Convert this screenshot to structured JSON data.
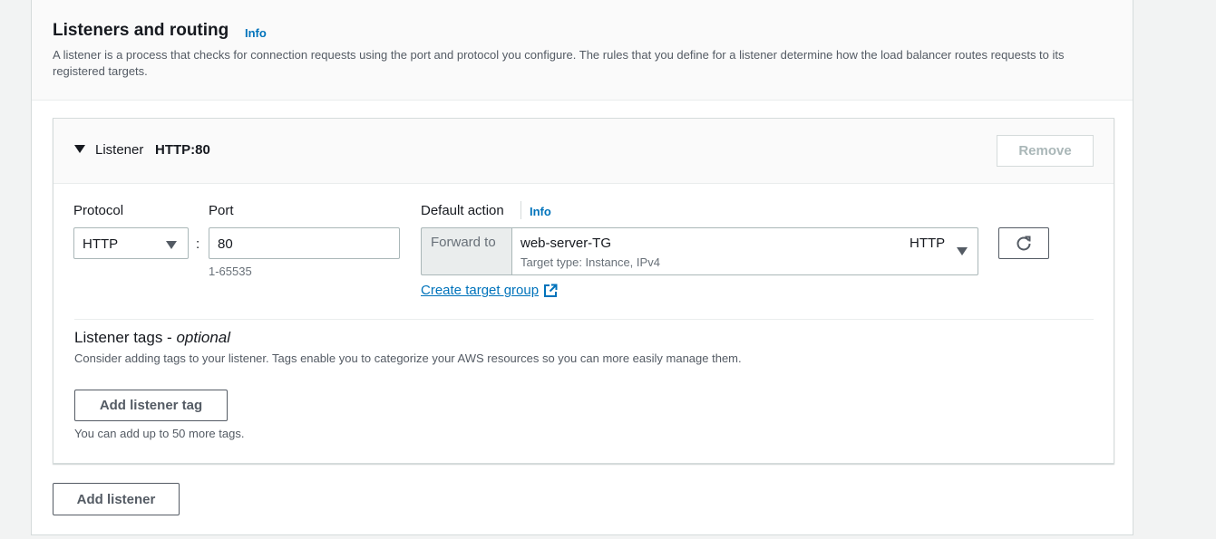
{
  "section": {
    "title": "Listeners and routing",
    "info_label": "Info",
    "description": "A listener is a process that checks for connection requests using the port and protocol you configure. The rules that you define for a listener determine how the load balancer routes requests to its registered targets."
  },
  "listener": {
    "label": "Listener",
    "name": "HTTP:80",
    "remove_label": "Remove",
    "protocol_label": "Protocol",
    "protocol_value": "HTTP",
    "colon": ":",
    "port_label": "Port",
    "port_value": "80",
    "port_hint": "1-65535",
    "default_action_label": "Default action",
    "default_action_info": "Info",
    "forward_to_label": "Forward to",
    "target_group_name": "web-server-TG",
    "target_group_protocol": "HTTP",
    "target_type": "Target type: Instance, IPv4",
    "create_target_group_label": "Create target group"
  },
  "tags": {
    "title": "Listener tags - ",
    "title_optional": "optional",
    "description": "Consider adding tags to your listener. Tags enable you to categorize your AWS resources so you can more easily manage them.",
    "add_tag_label": "Add listener tag",
    "hint": "You can add up to 50 more tags."
  },
  "footer": {
    "add_listener_label": "Add listener"
  },
  "icons": {
    "expand": "caret-down-icon",
    "dropdown": "triangle-down-icon",
    "refresh": "refresh-icon",
    "external": "external-link-icon"
  },
  "colors": {
    "link": "#0073bb",
    "text": "#16191f",
    "muted": "#687078",
    "border": "#aab7b8"
  }
}
